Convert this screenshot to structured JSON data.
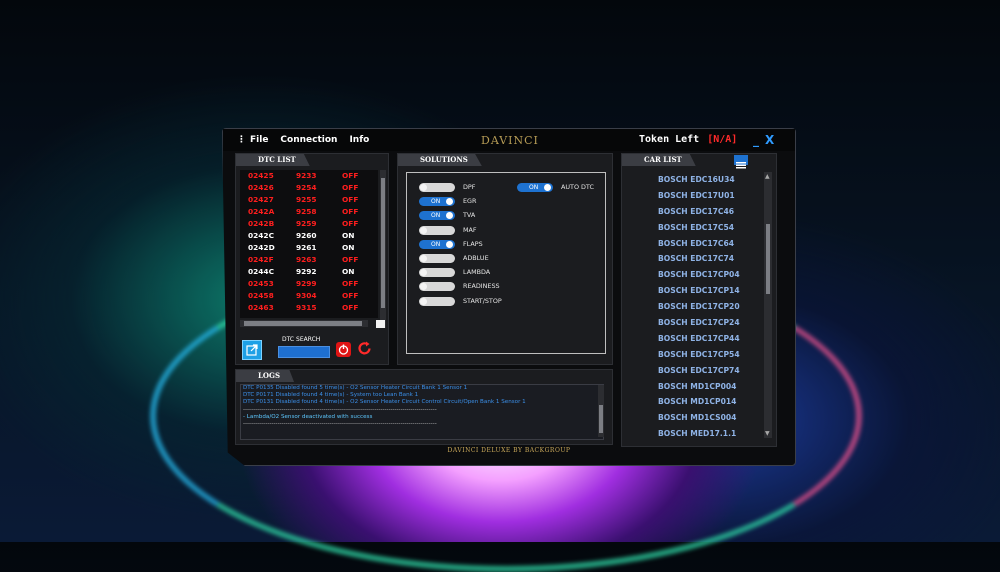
{
  "app": {
    "title": "DAVINCI",
    "footer": "DAVINCI DELUXE BY BACKGROUP"
  },
  "menu": {
    "file": "File",
    "connection": "Connection",
    "info": "Info"
  },
  "token": {
    "label": "Token Left",
    "value": "[N/A]"
  },
  "window": {
    "minimize": "_",
    "close": "X"
  },
  "dtc": {
    "title": "DTC LIST",
    "search_label": "DTC SEARCH",
    "rows": [
      {
        "code": "02425",
        "num": "9233",
        "state": "OFF",
        "color": "#ff1e1e"
      },
      {
        "code": "02426",
        "num": "9254",
        "state": "OFF",
        "color": "#ff1e1e"
      },
      {
        "code": "02427",
        "num": "9255",
        "state": "OFF",
        "color": "#ff1e1e"
      },
      {
        "code": "0242A",
        "num": "9258",
        "state": "OFF",
        "color": "#ff1e1e"
      },
      {
        "code": "0242B",
        "num": "9259",
        "state": "OFF",
        "color": "#ff1e1e"
      },
      {
        "code": "0242C",
        "num": "9260",
        "state": "ON",
        "color": "#ffffff"
      },
      {
        "code": "0242D",
        "num": "9261",
        "state": "ON",
        "color": "#ffffff"
      },
      {
        "code": "0242F",
        "num": "9263",
        "state": "OFF",
        "color": "#ff1e1e"
      },
      {
        "code": "0244C",
        "num": "9292",
        "state": "ON",
        "color": "#ffffff"
      },
      {
        "code": "02453",
        "num": "9299",
        "state": "OFF",
        "color": "#ff1e1e"
      },
      {
        "code": "02458",
        "num": "9304",
        "state": "OFF",
        "color": "#ff1e1e"
      },
      {
        "code": "02463",
        "num": "9315",
        "state": "OFF",
        "color": "#ff1e1e"
      }
    ]
  },
  "solutions": {
    "title": "SOLUTIONS",
    "toggles": [
      {
        "label": "DPF",
        "on": false,
        "on_text": ""
      },
      {
        "label": "EGR",
        "on": true,
        "on_text": "ON"
      },
      {
        "label": "TVA",
        "on": true,
        "on_text": "ON"
      },
      {
        "label": "MAF",
        "on": false,
        "on_text": ""
      },
      {
        "label": "FLAPS",
        "on": true,
        "on_text": "ON"
      },
      {
        "label": "ADBLUE",
        "on": false,
        "on_text": ""
      },
      {
        "label": "LAMBDA",
        "on": false,
        "on_text": ""
      },
      {
        "label": "READINESS",
        "on": false,
        "on_text": ""
      },
      {
        "label": "START/STOP",
        "on": false,
        "on_text": ""
      }
    ],
    "auto_dtc": {
      "label": "AUTO DTC",
      "on": true,
      "on_text": "ON"
    }
  },
  "cars": {
    "title": "CAR LIST",
    "items": [
      "BOSCH EDC16U34",
      "BOSCH EDC17U01",
      "BOSCH EDC17C46",
      "BOSCH EDC17C54",
      "BOSCH EDC17C64",
      "BOSCH EDC17C74",
      "BOSCH EDC17CP04",
      "BOSCH EDC17CP14",
      "BOSCH EDC17CP20",
      "BOSCH EDC17CP24",
      "BOSCH EDC17CP44",
      "BOSCH EDC17CP54",
      "BOSCH EDC17CP74",
      "BOSCH MD1CP004",
      "BOSCH MD1CP014",
      "BOSCH MD1CS004",
      "BOSCH MED17.1.1"
    ]
  },
  "logs": {
    "title": "LOGS",
    "lines": [
      {
        "text": "DTC P0135 Disabled found 5 time(s) - O2 Sensor Heater Circuit Bank 1 Sensor 1",
        "color": "#3b8fe8"
      },
      {
        "text": "DTC P0171 Disabled found 4 time(s) - System too Lean Bank 1",
        "color": "#3b8fe8"
      },
      {
        "text": "DTC P0131 Disabled found 4 time(s) - O2 Sensor Heater Circuit Control Circuit/Open Bank 1 Sensor 1",
        "color": "#3b8fe8"
      },
      {
        "text": "------------------------------------------------------------------------------------------------",
        "color": "#c8c8c8"
      },
      {
        "text": "- Lambda/O2 Sensor deactivated with success",
        "color": "#5ec8ff"
      },
      {
        "text": "------------------------------------------------------------------------------------------------",
        "color": "#c8c8c8"
      }
    ]
  },
  "colors": {
    "accent": "#1e72d0",
    "off": "#ff1e1e",
    "title_gold": "#b59b55"
  }
}
